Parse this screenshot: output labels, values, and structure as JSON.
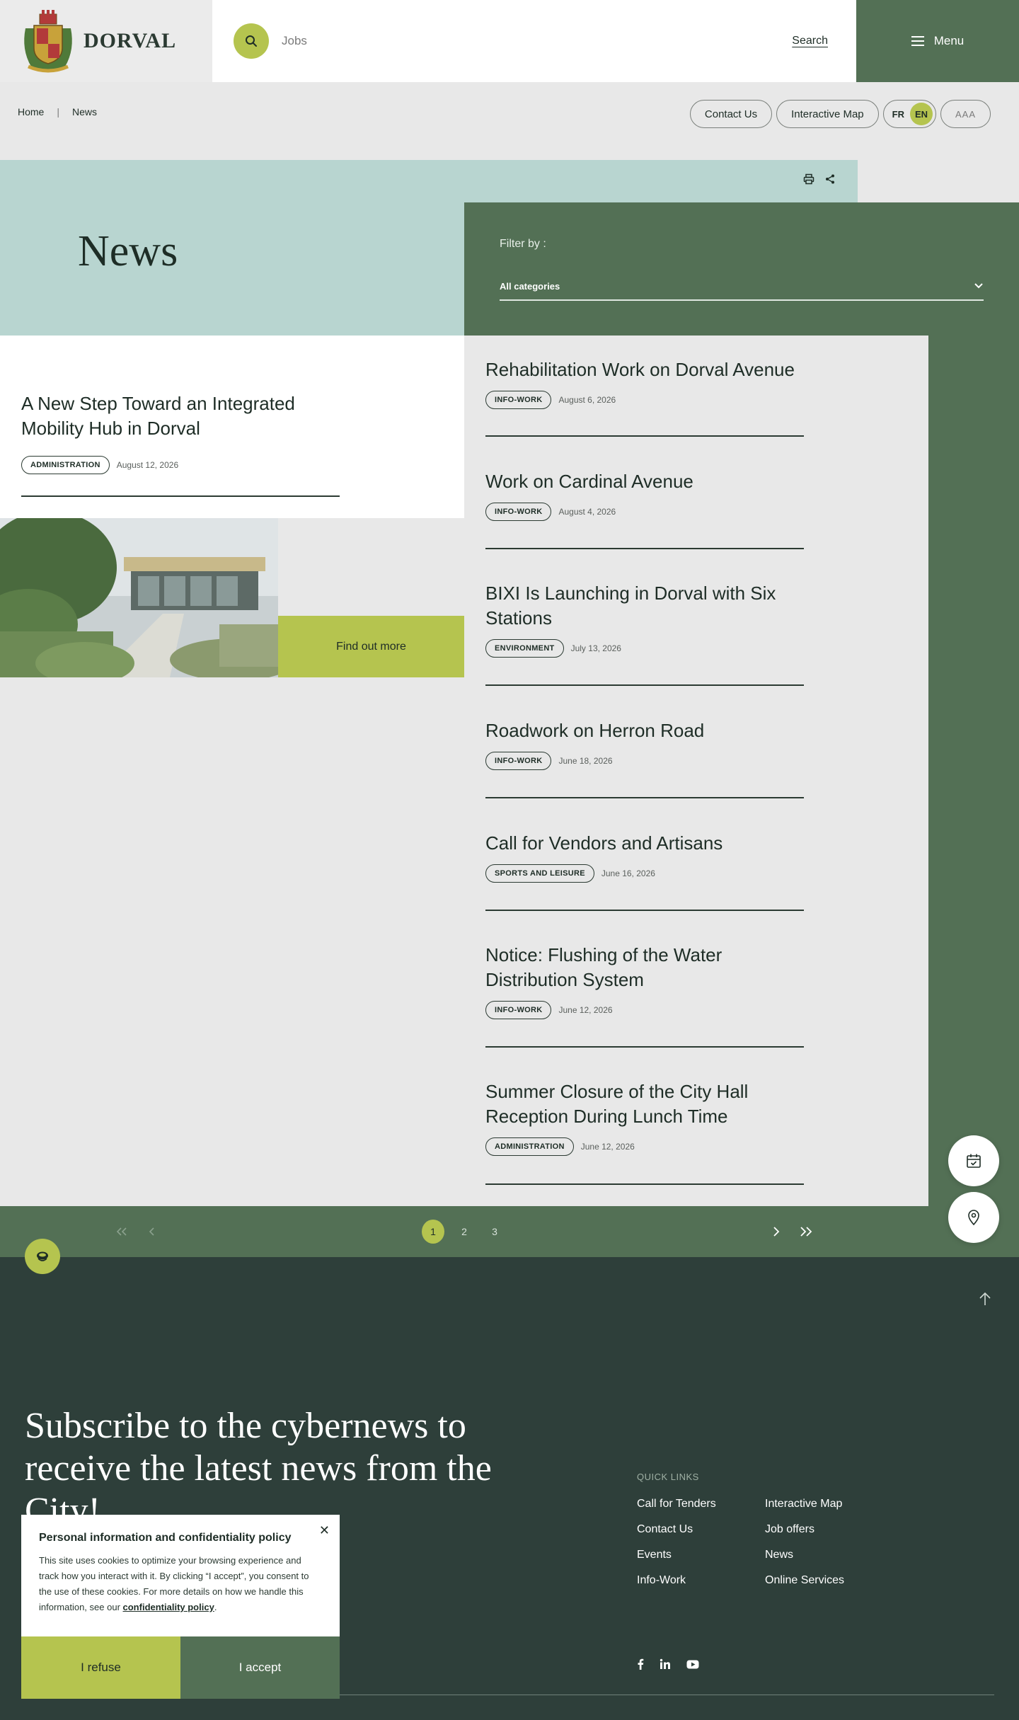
{
  "header": {
    "logo_text": "DORVAL",
    "search_placeholder": "Jobs",
    "search_label": "Search",
    "menu_label": "Menu"
  },
  "breadcrumb": [
    "Home",
    "News"
  ],
  "top_pills": {
    "contact": "Contact Us",
    "map": "Interactive Map",
    "lang_fr": "FR",
    "lang_en": "EN",
    "text_size": "AAA"
  },
  "hero": {
    "title": "News",
    "filter_label": "Filter by :",
    "filter_value": "All categories"
  },
  "featured": {
    "title": "A New Step Toward an Integrated Mobility Hub in Dorval",
    "tag": "ADMINISTRATION",
    "date": "August 12, 2026",
    "cta": "Find out more"
  },
  "articles": [
    {
      "title": "Rehabilitation Work on Dorval Avenue",
      "tag": "INFO-WORK",
      "date": "August 6, 2026"
    },
    {
      "title": "Work on Cardinal Avenue",
      "tag": "INFO-WORK",
      "date": "August 4, 2026"
    },
    {
      "title": "BIXI Is Launching in Dorval with Six Stations",
      "tag": "ENVIRONMENT",
      "date": "July 13, 2026"
    },
    {
      "title": "Roadwork on Herron Road",
      "tag": "INFO-WORK",
      "date": "June 18, 2026"
    },
    {
      "title": "Call for Vendors and Artisans",
      "tag": "SPORTS AND LEISURE",
      "date": "June 16, 2026"
    },
    {
      "title": "Notice: Flushing of the Water Distribution System",
      "tag": "INFO-WORK",
      "date": "June 12, 2026"
    },
    {
      "title": "Summer Closure of the City Hall Reception During Lunch Time",
      "tag": "ADMINISTRATION",
      "date": "June 12, 2026"
    }
  ],
  "pagination": {
    "pages": [
      "1",
      "2",
      "3"
    ],
    "current": "1"
  },
  "footer": {
    "subscribe": "Subscribe to the cybernews to receive the latest news from the City!",
    "quick_links_label": "QUICK LINKS",
    "quick_links_col1": [
      "Call for Tenders",
      "Contact Us",
      "Events",
      "Info-Work"
    ],
    "quick_links_col2": [
      "Interactive Map",
      "Job offers",
      "News",
      "Online Services"
    ]
  },
  "cookie": {
    "title": "Personal information and confidentiality policy",
    "text": "This site uses cookies to optimize your browsing experience and track how you interact with it. By clicking “I accept”, you consent to the use of these cookies. For more details on how we handle this information, see our ",
    "link": "confidentiality policy",
    "text_end": ".",
    "refuse": "I refuse",
    "accept": "I accept"
  },
  "colors": {
    "accent": "#b5c44f",
    "primary_green": "#537055",
    "teal": "#b8d5d0",
    "footer": "#2e3f3a"
  }
}
